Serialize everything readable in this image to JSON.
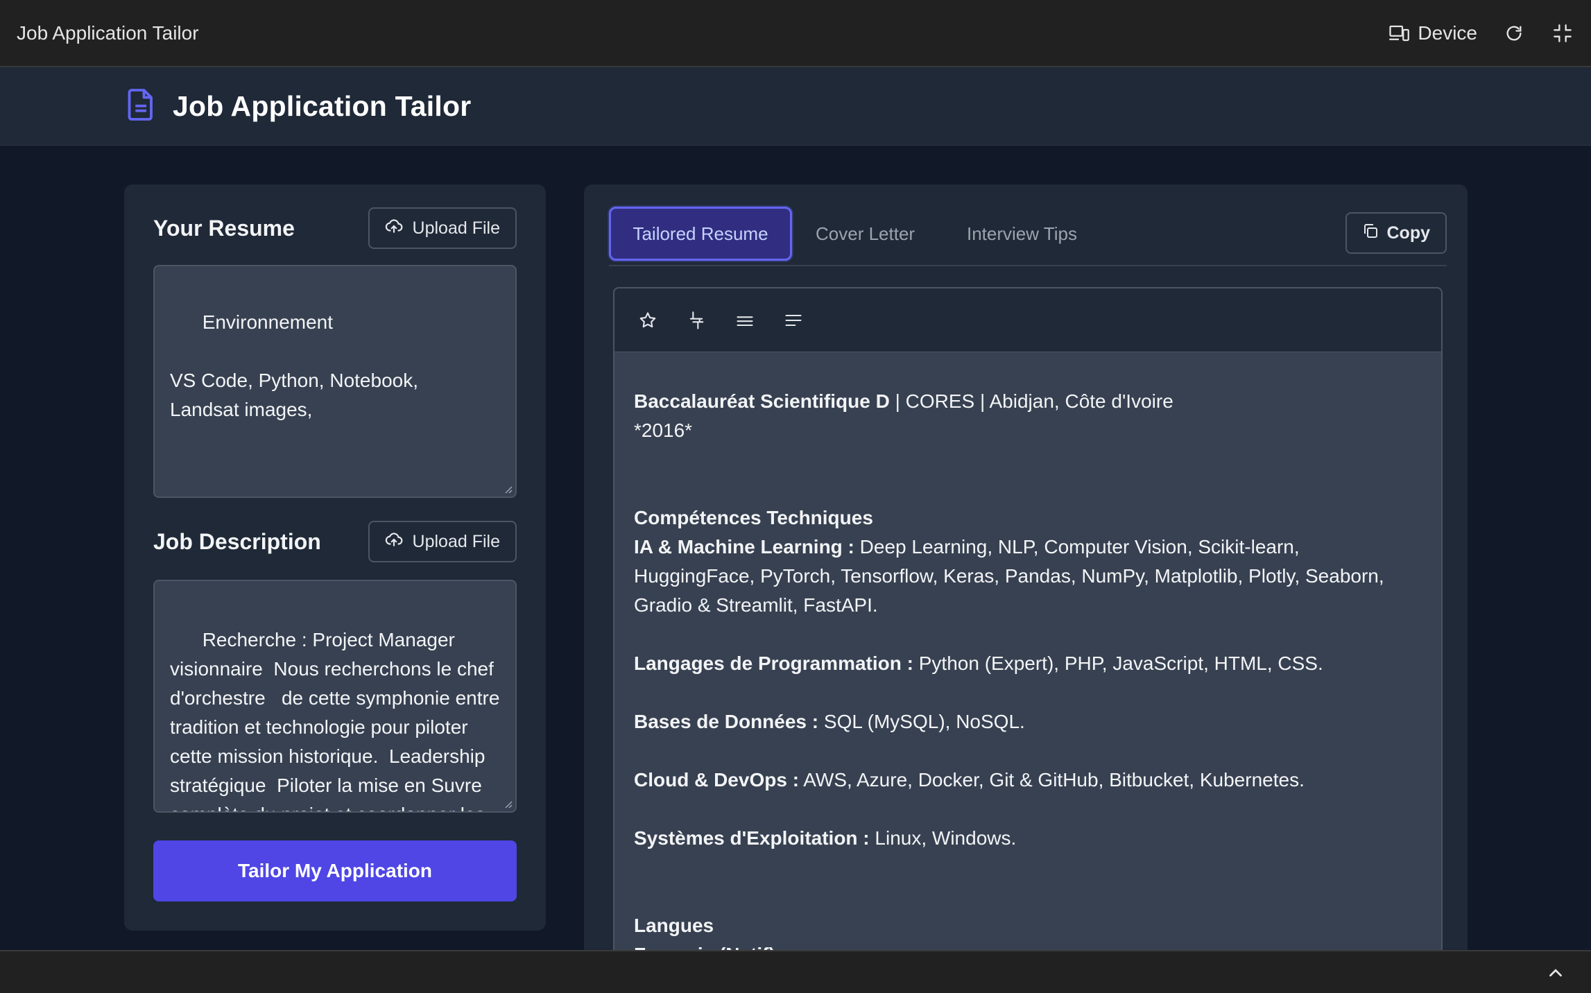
{
  "chrome": {
    "title": "Job Application Tailor",
    "device_label": "Device",
    "icons": [
      "device-icon",
      "refresh-icon",
      "fullscreen-exit-icon"
    ]
  },
  "header": {
    "title": "Job Application Tailor",
    "icon": "document-icon",
    "accent": "#6366f1"
  },
  "resume": {
    "title": "Your Resume",
    "upload_label": "Upload File",
    "text": "Environnement\n\nVS Code, Python, Notebook,\nLandsat images,"
  },
  "job": {
    "title": "Job Description",
    "upload_label": "Upload File",
    "text": "Recherche : Project Manager visionnaire  Nous recherchons le chef d'orchestre   de cette symphonie entre tradition et technologie pour piloter cette mission historique.  Leadership stratégique  Piloter la mise en Suvre complète du projet et coordonner les"
  },
  "tailor_button": "Tailor My Application",
  "tabs": [
    {
      "label": "Tailored Resume",
      "active": true
    },
    {
      "label": "Cover Letter",
      "active": false
    },
    {
      "label": "Interview Tips",
      "active": false
    }
  ],
  "copy_label": "Copy",
  "toolbar_icons": [
    "star-icon",
    "split-icon",
    "align-justify-icon",
    "align-left-icon"
  ],
  "content": {
    "bac_title": "Baccalauréat Scientifique D",
    "bac_rest": " | CORES | Abidjan, Côte d'Ivoire",
    "bac_year": "*2016*",
    "skills_title": "Compétences Techniques",
    "ai_label": "IA & Machine Learning :",
    "ai_text": " Deep Learning, NLP, Computer Vision, Scikit-learn, HuggingFace, PyTorch, Tensorflow, Keras, Pandas, NumPy, Matplotlib, Plotly, Seaborn, Gradio & Streamlit, FastAPI.",
    "lang_prog_label": "Langages de Programmation :",
    "lang_prog_text": " Python (Expert), PHP, JavaScript, HTML, CSS.",
    "db_label": "Bases de Données :",
    "db_text": " SQL (MySQL), NoSQL.",
    "cloud_label": "Cloud & DevOps :",
    "cloud_text": " AWS, Azure, Docker, Git & GitHub, Bitbucket, Kubernetes.",
    "os_label": "Systèmes d'Exploitation :",
    "os_text": " Linux, Windows.",
    "languages_title": "Langues",
    "languages_partial": "Français (Natif)"
  }
}
